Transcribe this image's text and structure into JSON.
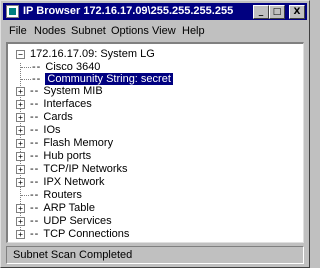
{
  "window": {
    "title": "IP Browser 172.16.17.09\\255.255.255.255",
    "minimize_label": "_",
    "maximize_label": "□",
    "close_label": "X"
  },
  "menu": {
    "file": "File",
    "nodes": "Nodes",
    "subnet": "Subnet",
    "options": "Options",
    "view": "View",
    "help": "Help"
  },
  "tree": {
    "root": {
      "label": "172.16.17.09: System LG",
      "expander": "−"
    },
    "children": [
      {
        "label": "Cisco 3640",
        "expander": ""
      },
      {
        "label": "Community String: secret",
        "expander": "",
        "selected": true
      },
      {
        "label": "System MIB",
        "expander": "+"
      },
      {
        "label": "Interfaces",
        "expander": "+"
      },
      {
        "label": "Cards",
        "expander": "+"
      },
      {
        "label": "IOs",
        "expander": "+"
      },
      {
        "label": "Flash Memory",
        "expander": "+"
      },
      {
        "label": "Hub ports",
        "expander": "+"
      },
      {
        "label": "TCP/IP Networks",
        "expander": "+"
      },
      {
        "label": "IPX Network",
        "expander": "+"
      },
      {
        "label": "Routers",
        "expander": ""
      },
      {
        "label": "ARP Table",
        "expander": "+"
      },
      {
        "label": "UDP Services",
        "expander": "+"
      },
      {
        "label": "TCP Connections",
        "expander": "+"
      }
    ]
  },
  "status": {
    "text": "Subnet Scan Completed"
  },
  "colors": {
    "titlebar": "#000080",
    "selection": "#000080",
    "face": "#c0c0c0"
  }
}
